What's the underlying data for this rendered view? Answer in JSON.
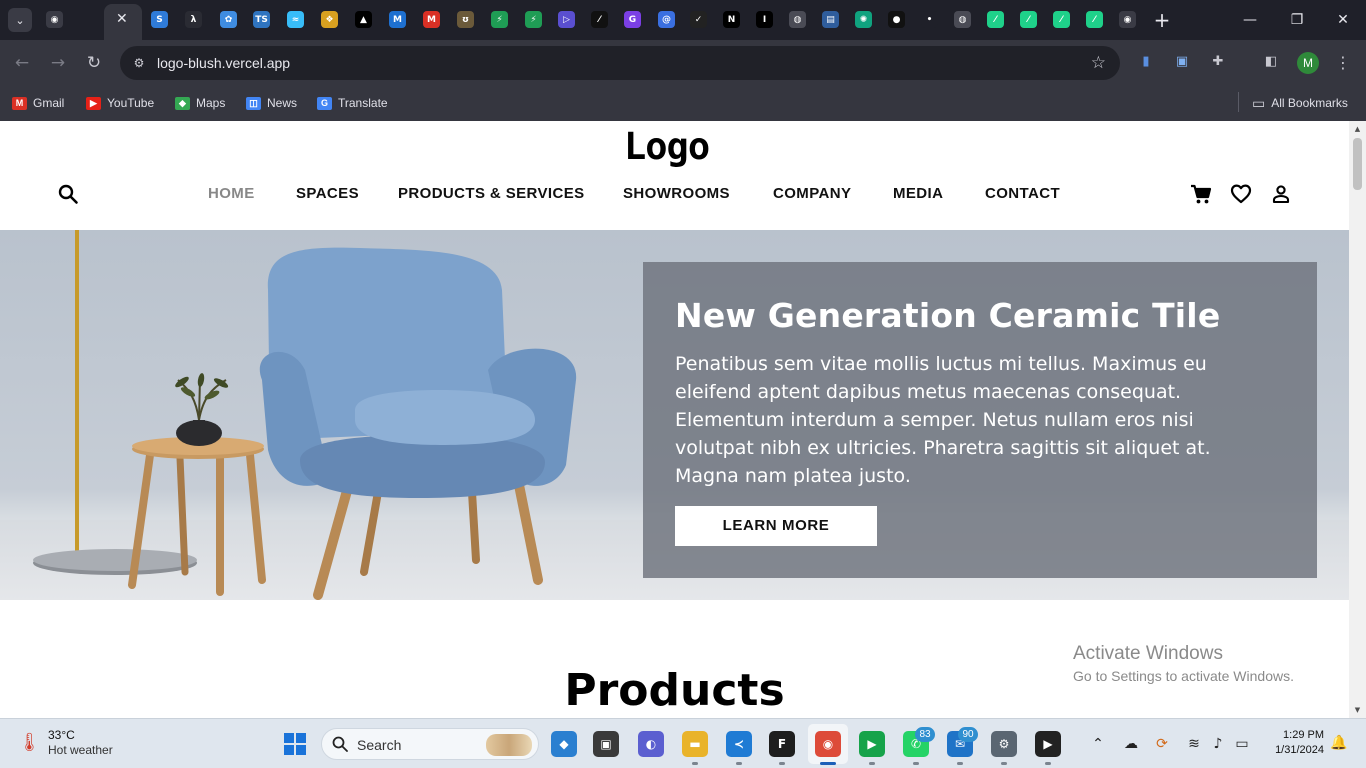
{
  "browser": {
    "tab_dropdown_label": "⌄",
    "active_tab_close": "✕",
    "new_tab_label": "+",
    "tab_favicons": [
      {
        "icon": "chrome-icon",
        "glyph": "◉",
        "color": "#3a3b45"
      },
      {
        "icon": "loading-icon",
        "glyph": "◌",
        "color": "#1f2029"
      },
      {
        "icon": "blue-s-icon",
        "glyph": "S",
        "color": "#2f7bd8"
      },
      {
        "icon": "dev-icon",
        "glyph": "λ",
        "color": "#2a2b33"
      },
      {
        "icon": "blue-tool-icon",
        "glyph": "✿",
        "color": "#3f8ce0"
      },
      {
        "icon": "typescript-icon",
        "glyph": "TS",
        "color": "#2f74c0"
      },
      {
        "icon": "tailwind-icon",
        "glyph": "≈",
        "color": "#38bdf8"
      },
      {
        "icon": "multicolor-icon",
        "glyph": "❖",
        "color": "#d8a020"
      },
      {
        "icon": "vercel-icon",
        "glyph": "▲",
        "color": "#000000"
      },
      {
        "icon": "mui-icon",
        "glyph": "M",
        "color": "#1e70d0"
      },
      {
        "icon": "gmail-icon",
        "glyph": "M",
        "color": "#d93025"
      },
      {
        "icon": "bear-icon",
        "glyph": "ʊ",
        "color": "#6b5a3a"
      },
      {
        "icon": "green-bolt-icon",
        "glyph": "⚡",
        "color": "#1f9d55"
      },
      {
        "icon": "green-bolt-icon",
        "glyph": "⚡",
        "color": "#1f9d55"
      },
      {
        "icon": "play-icon",
        "glyph": "▷",
        "color": "#5a4fd0"
      },
      {
        "icon": "slash-icon",
        "glyph": "⁄",
        "color": "#111111"
      },
      {
        "icon": "purple-g-icon",
        "glyph": "G",
        "color": "#7b3fe4"
      },
      {
        "icon": "blue-c-icon",
        "glyph": "@",
        "color": "#3a6fe0"
      },
      {
        "icon": "check-circle-icon",
        "glyph": "✓",
        "color": "#222222"
      },
      {
        "icon": "nextjs-icon",
        "glyph": "N",
        "color": "#000000"
      },
      {
        "icon": "i-icon",
        "glyph": "I",
        "color": "#000000"
      },
      {
        "icon": "globe-icon",
        "glyph": "◍",
        "color": "#4a4b55"
      },
      {
        "icon": "doc-icon",
        "glyph": "▤",
        "color": "#2f5d9c"
      },
      {
        "icon": "openai-icon",
        "glyph": "✺",
        "color": "#10a37f"
      },
      {
        "icon": "eye-icon",
        "glyph": "●",
        "color": "#111111"
      },
      {
        "icon": "dot-icon",
        "glyph": "•",
        "color": "#1f2029"
      },
      {
        "icon": "globe-icon",
        "glyph": "◍",
        "color": "#4a4b55"
      },
      {
        "icon": "green-slash-icon",
        "glyph": "⁄",
        "color": "#1fd18a"
      },
      {
        "icon": "green-slash-icon",
        "glyph": "⁄",
        "color": "#1fd18a"
      },
      {
        "icon": "green-slash-icon",
        "glyph": "⁄",
        "color": "#1fd18a"
      },
      {
        "icon": "green-slash-icon",
        "glyph": "⁄",
        "color": "#1fd18a"
      },
      {
        "icon": "chrome-icon",
        "glyph": "◉",
        "color": "#3a3b45"
      }
    ],
    "window_controls": {
      "minimize": "—",
      "restore": "❐",
      "close": "✕"
    },
    "url": "logo-blush.vercel.app",
    "profile_initial": "M",
    "bookmarks": [
      {
        "label": "Gmail",
        "icon": "gmail-icon",
        "color": "#d93025",
        "glyph": "M"
      },
      {
        "label": "YouTube",
        "icon": "youtube-icon",
        "color": "#e62117",
        "glyph": "▶"
      },
      {
        "label": "Maps",
        "icon": "maps-icon",
        "color": "#34a853",
        "glyph": "◆"
      },
      {
        "label": "News",
        "icon": "news-icon",
        "color": "#4285f4",
        "glyph": "◫"
      },
      {
        "label": "Translate",
        "icon": "translate-icon",
        "color": "#4285f4",
        "glyph": "G"
      }
    ],
    "all_bookmarks_label": "All Bookmarks"
  },
  "site": {
    "logo_text": "Logo",
    "nav": [
      {
        "label": "HOME",
        "active": true
      },
      {
        "label": "SPACES",
        "active": false
      },
      {
        "label": "PRODUCTS & SERVICES",
        "active": false
      },
      {
        "label": "SHOWROOMS",
        "active": false
      },
      {
        "label": "COMPANY",
        "active": false
      },
      {
        "label": "MEDIA",
        "active": false
      },
      {
        "label": "CONTACT",
        "active": false
      }
    ],
    "hero": {
      "title": "New Generation Ceramic Tile",
      "text": "Penatibus sem vitae mollis luctus mi tellus. Maximus eu eleifend aptent dapibus metus maecenas consequat. Elementum interdum a semper. Netus nullam eros nisi volutpat nibh ex ultricies. Pharetra sagittis sit aliquet at. Magna nam platea justo.",
      "button_label": "LEARN MORE"
    },
    "section_title": "Products",
    "nav_active_color": "#888888"
  },
  "watermark": {
    "line1": "Activate Windows",
    "line2": "Go to Settings to activate Windows."
  },
  "taskbar": {
    "weather_temp": "33°C",
    "weather_desc": "Hot weather",
    "search_placeholder": "Search",
    "apps": [
      {
        "name": "copilot-icon",
        "glyph": "◆",
        "color": "#2a7fd0",
        "run": false
      },
      {
        "name": "task-view-icon",
        "glyph": "▣",
        "color": "#3a3a3a",
        "run": false
      },
      {
        "name": "chat-icon",
        "glyph": "◐",
        "color": "#5b5fd0",
        "run": false
      },
      {
        "name": "file-explorer-icon",
        "glyph": "▬",
        "color": "#e9b32a",
        "run": true
      },
      {
        "name": "vscode-icon",
        "glyph": "≺",
        "color": "#1f7bd4",
        "run": true
      },
      {
        "name": "figma-icon",
        "glyph": "F",
        "color": "#1e1e1e",
        "run": true
      },
      {
        "name": "chrome-icon",
        "glyph": "◉",
        "color": "#dd4b39",
        "run": true
      },
      {
        "name": "meet-icon",
        "glyph": "▶",
        "color": "#16a34a",
        "run": true
      },
      {
        "name": "whatsapp-icon",
        "glyph": "✆",
        "color": "#25d366",
        "run": true
      },
      {
        "name": "outlook-icon",
        "glyph": "✉",
        "color": "#1f73c7",
        "run": true
      },
      {
        "name": "settings-icon",
        "glyph": "⚙",
        "color": "#5a6672",
        "run": true
      },
      {
        "name": "media-player-icon",
        "glyph": "▶",
        "color": "#222222",
        "run": true
      }
    ],
    "badges": {
      "whatsapp": "83",
      "outlook": "90"
    },
    "time": "1:29 PM",
    "date": "1/31/2024"
  }
}
